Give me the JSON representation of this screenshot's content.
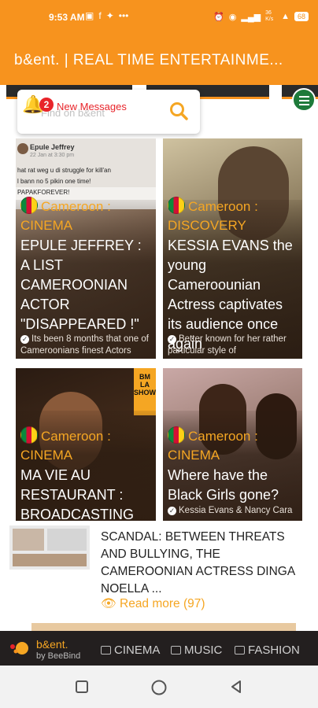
{
  "status_bar": {
    "time": "9:53 AM",
    "left_icons": [
      "gallery-icon",
      "facebook-icon",
      "twitter-icon",
      "more-dots-icon"
    ],
    "right_icons": [
      "alarm-icon",
      "hotspot-icon",
      "signal-icon",
      "data-speed-icon",
      "wifi-icon"
    ],
    "data_speed": "36 K/s",
    "battery": "68"
  },
  "app_bar": {
    "title": "b&ent. | REAL TIME ENTERTAINME..."
  },
  "notification": {
    "count": "2",
    "label": "New Messages"
  },
  "search": {
    "placeholder": "Find on b&ent"
  },
  "cards": [
    {
      "category": "Cameroon : CINEMA",
      "headline": "EPULE JEFFREY : A LIST CAMEROONIAN ACTOR \"DISAPPEARED !\"",
      "excerpt": "Its been 8 months that one of Cameroonians finest Actors"
    },
    {
      "category": "Cameroon : DISCOVERY",
      "headline": "KESSIA EVANS the young Cameroounian Actress captivates its audience once again",
      "excerpt": "Better known for her rather particular style of"
    },
    {
      "category": "Cameroon : CINEMA",
      "headline": "MA VIE AU RESTAURANT : BROADCASTING",
      "excerpt": ""
    },
    {
      "category": "Cameroon : CINEMA",
      "headline": "Where have the Black Girls gone?",
      "excerpt": "Kessia Evans & Nancy Cara"
    }
  ],
  "card1_post": {
    "author": "Epule Jeffrey",
    "date": "22 Jan at 3:30 pm",
    "lines": [
      "hat rat weg u di struggle for kill'an",
      "l bann no 5 pikin one time!",
      "PAPAKFOREVER!"
    ]
  },
  "card3_banner": "BM LA SHOW",
  "featured": {
    "title": "SCANDAL: BETWEEN THREATS AND BULLYING, THE CAMEROONIAN ACTRESS DINGA NOELLA ...",
    "read_more": "Read more (97)"
  },
  "bottom_nav": {
    "brand": "b&ent.",
    "byline": "by BeeBind",
    "items": [
      "CINEMA",
      "MUSIC",
      "FASHION"
    ]
  },
  "colors": {
    "brand_orange": "#f7931e",
    "accent_gold": "#f5a623",
    "badge_red": "#e8242a",
    "nav_dark": "#231f1f"
  }
}
